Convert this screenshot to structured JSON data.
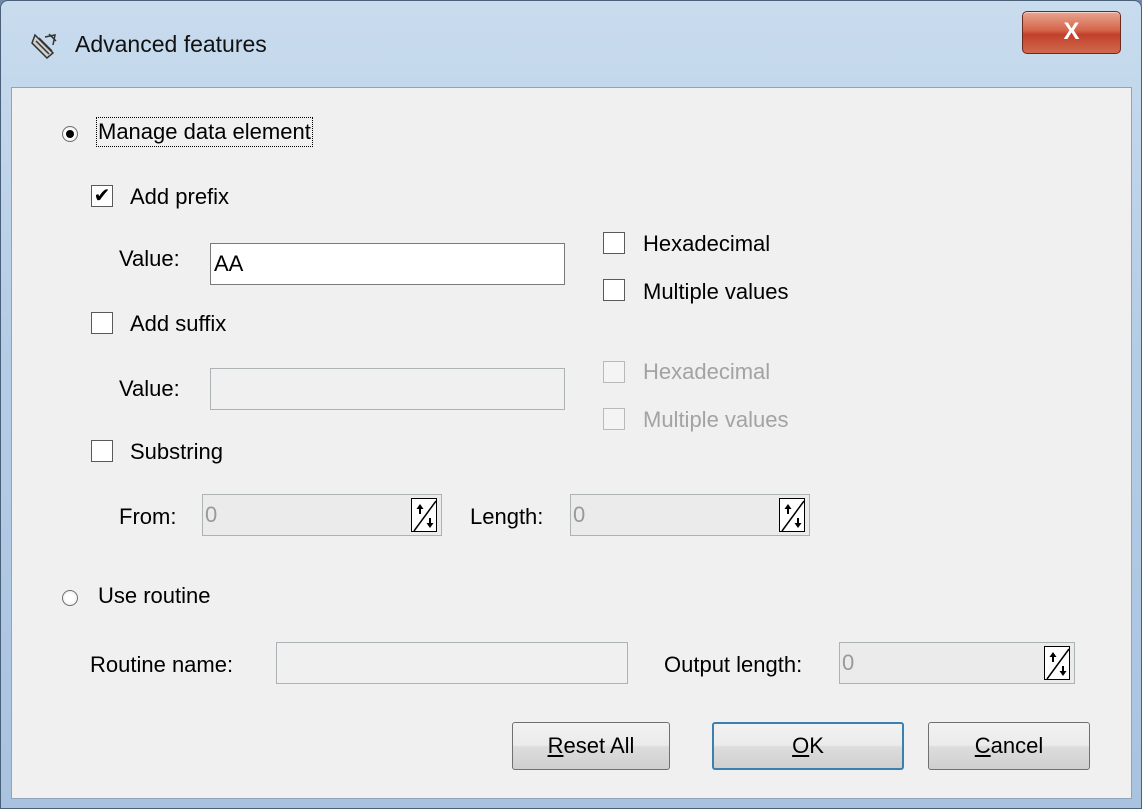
{
  "window": {
    "title": "Advanced features",
    "close_glyph": "X"
  },
  "manage": {
    "label": "Manage data element",
    "selected": true,
    "prefix": {
      "label": "Add prefix",
      "checked": true,
      "value_label": "Value:",
      "value": "AA",
      "hex_label": "Hexadecimal",
      "multi_label": "Multiple values"
    },
    "suffix": {
      "label": "Add suffix",
      "checked": false,
      "value_label": "Value:",
      "value": "",
      "hex_label": "Hexadecimal",
      "multi_label": "Multiple values"
    },
    "substring": {
      "label": "Substring",
      "checked": false,
      "from_label": "From:",
      "from_value": "0",
      "length_label": "Length:",
      "length_value": "0"
    }
  },
  "routine": {
    "label": "Use routine",
    "selected": false,
    "name_label": "Routine name:",
    "name_value": "",
    "output_label": "Output length:",
    "output_value": "0"
  },
  "buttons": {
    "reset": {
      "mnemonic": "R",
      "rest": "eset All"
    },
    "ok": {
      "mnemonic": "O",
      "rest": "K"
    },
    "cancel": {
      "mnemonic": "C",
      "rest": "ancel"
    }
  },
  "icons": {
    "app": "satellite-dish-icon",
    "spin": "spin-arrows-icon"
  },
  "colors": {
    "close_button": "#c94a31",
    "disabled_text": "#a3a3a3",
    "default_button_border": "#3c7fb1"
  }
}
